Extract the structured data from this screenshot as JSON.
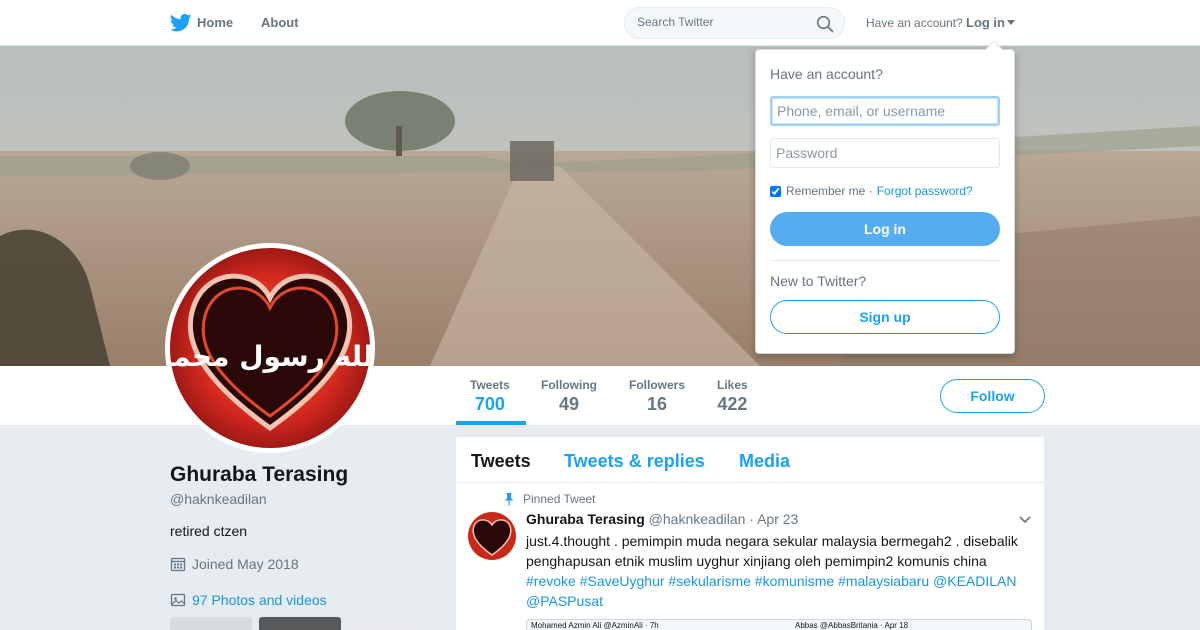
{
  "nav": {
    "home_label": "Home",
    "about_label": "About",
    "search_placeholder": "Search Twitter",
    "have_account_text": "Have an account?",
    "login_label": "Log in"
  },
  "profile": {
    "name": "Ghuraba Terasing",
    "handle": "@haknkeadilan",
    "bio": "retired ctzen",
    "joined": "Joined May 2018",
    "photos_link": "97 Photos and videos",
    "avatar_caption": "الله رسول محمد"
  },
  "stats": [
    {
      "label": "Tweets",
      "value": "700"
    },
    {
      "label": "Following",
      "value": "49"
    },
    {
      "label": "Followers",
      "value": "16"
    },
    {
      "label": "Likes",
      "value": "422"
    }
  ],
  "follow_label": "Follow",
  "timeline": {
    "tabs": [
      "Tweets",
      "Tweets & replies",
      "Media"
    ],
    "pinned_label": "Pinned Tweet",
    "tweet": {
      "name": "Ghuraba Terasing",
      "handle": "@haknkeadilan",
      "date": "· Apr 23",
      "text_line1": "just.4.thought . pemimpin muda negara sekular malaysia bermegah2 . disebalik",
      "text_line2": "penghapusan etnik muslim uyghur xinjiang oleh pemimpin2 komunis china",
      "hashtags": [
        "#revoke",
        "#SaveUyghur",
        "#sekularisme",
        "#komunisme",
        "#malaysiabaru",
        "@KEADILAN"
      ],
      "mention_last": "@PASPusat",
      "media_preview_left": "Mohamed Azmin Ali @AzminAli · 7h",
      "media_preview_right": "Abbas @AbbasBritania · Apr 18"
    }
  },
  "login_dropdown": {
    "title": "Have an account?",
    "username_placeholder": "Phone, email, or username",
    "password_placeholder": "Password",
    "remember_label": "Remember me ·",
    "forgot_label": "Forgot password?",
    "login_button": "Log in",
    "new_text": "New to Twitter?",
    "signup_button": "Sign up"
  },
  "colors": {
    "accent": "#1da1f2",
    "login_button_bg": "#55acee",
    "page_bg": "#e6ecf0"
  }
}
